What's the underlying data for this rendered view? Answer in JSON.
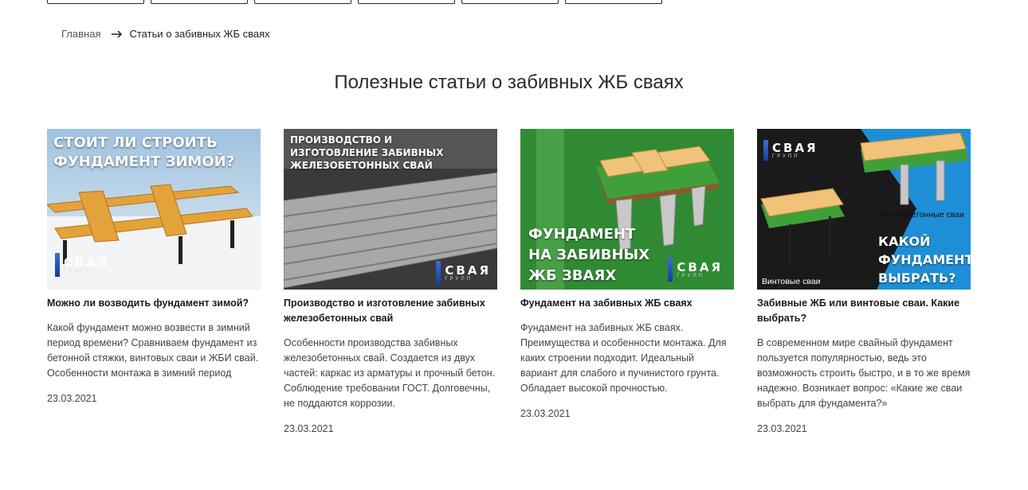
{
  "breadcrumb": {
    "home": "Главная",
    "current": "Статьи о забивных ЖБ сваях"
  },
  "page": {
    "title": "Полезные статьи о забивных ЖБ сваях"
  },
  "top_tabs_count": 6,
  "logo": {
    "word": "СВАЯ",
    "sub": "ГРУПП"
  },
  "cards": [
    {
      "image_caption": "СТОИТ ЛИ СТРОИТЬ ФУНДАМЕНТ ЗИМОЙ?",
      "title": "Можно ли возводить фундамент зимой?",
      "desc": "Какой фундамент можно возвести в зимний период времени? Сравниваем фундамент из бетонной стяжки, винтовых сваи и ЖБИ свай. Особенности монтажа в зимний период",
      "date": "23.03.2021"
    },
    {
      "image_caption": "ПРОИЗВОДСТВО И ИЗГОТОВЛЕНИЕ ЗАБИВНЫХ ЖЕЛЕЗОБЕТОННЫХ СВАЙ",
      "title": "Производство и изготовление забивных железобетонных свай",
      "desc": "Особенности производства забивных железобетонных свай. Создается из двух частей: каркас из арматуры и прочный бетон. Соблюдение требовании ГОСТ. Долговечны, не поддаются коррозии.",
      "date": "23.03.2021"
    },
    {
      "image_caption": "ФУНДАМЕНТ НА ЗАБИВНЫХ ЖБ ЗВАЯХ",
      "title": "Фундамент на забивных ЖБ сваях",
      "desc": "Фундамент на забивных ЖБ сваях. Преимущества и особенности монтажа. Для каких строении подходит. Идеальный вариант для слабого и пучинистого грунта. Обладает высокой прочностью.",
      "date": "23.03.2021"
    },
    {
      "image_caption": "КАКОЙ ФУНДАМЕНТ ВЫБРАТЬ?",
      "image_label_left": "Винтовые сваи",
      "image_label_right": "Железобетонные сваи",
      "title": "Забивные ЖБ или винтовые сваи. Какие выбрать?",
      "desc": "В современном мире свайный фундамент пользуется популярностью, ведь это возможность строить быстро, и в то же время надежно. Возникает вопрос: «Какие же сваи выбрать для фундамента?»",
      "date": "23.03.2021"
    }
  ],
  "colors": {
    "tab_border": "#1d2350",
    "winter_sky": "#bcd6ea",
    "wood": "#e3a23a",
    "concrete": "#9a9a9a",
    "grass_green": "#3fa03a",
    "blue_panel": "#1e8fd6"
  },
  "icons": {
    "breadcrumb_separator": "arrow-right-icon"
  }
}
